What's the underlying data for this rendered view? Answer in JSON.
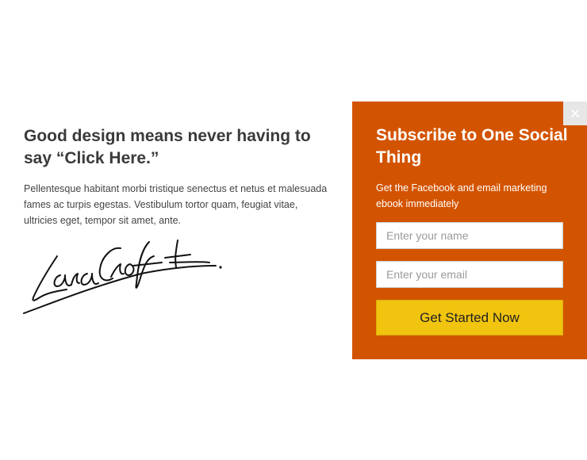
{
  "content": {
    "headline": "Good design means never having to say “Click Here.”",
    "body": "Pellentesque habitant morbi tristique senectus et netus et malesuada fames ac turpis egestas. Vestibulum tortor quam, feugiat vitae, ultricies eget, tempor sit amet, ante.",
    "signature_text": "LaraCroft"
  },
  "popup": {
    "title": "Subscribe to One Social Thing",
    "subtitle": "Get the Facebook and email marketing ebook immediately",
    "name_placeholder": "Enter your name",
    "name_value": "",
    "email_placeholder": "Enter your email",
    "email_value": "",
    "cta_label": "Get Started Now",
    "close_icon": "close-icon"
  },
  "colors": {
    "panel_bg": "#d35400",
    "cta_bg": "#f1c40f",
    "close_bg": "#e6e6e6",
    "headline": "#3a3a3a",
    "body_text": "#444444"
  }
}
